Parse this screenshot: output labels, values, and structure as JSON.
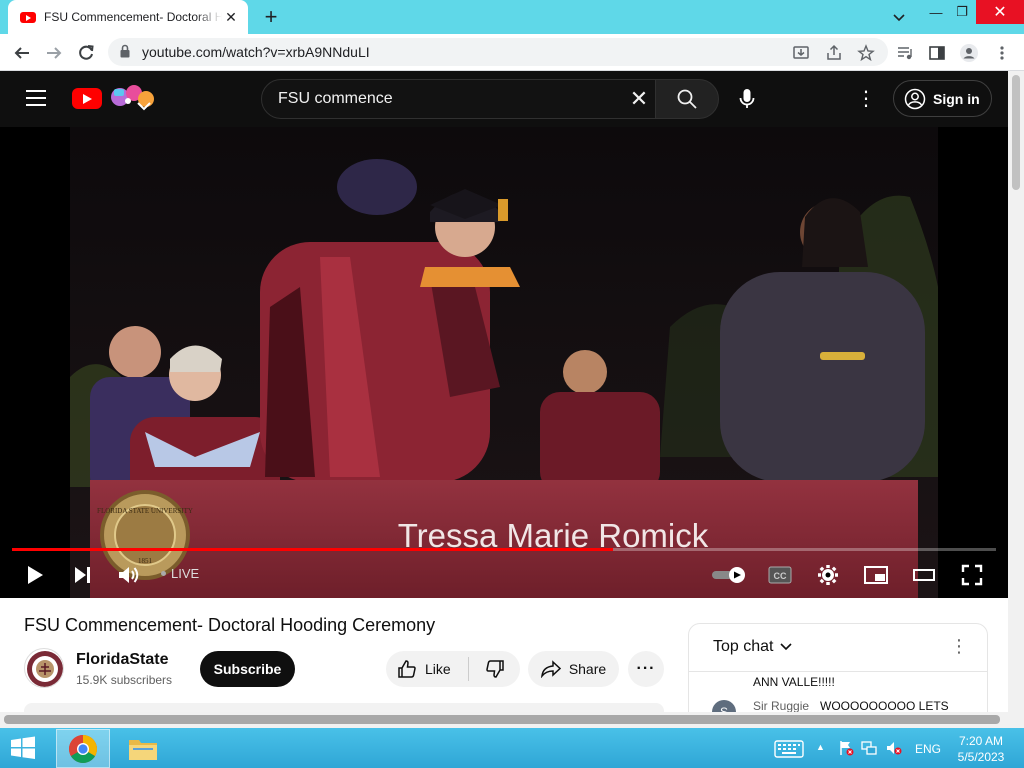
{
  "browser": {
    "tab_title": "FSU Commencement- Doctoral Hooding Ceremony - YouTube",
    "tab_close": "✕",
    "new_tab": "+",
    "url": "youtube.com/watch?v=xrbA9NNduLI",
    "window_controls": {
      "minimize": "—",
      "restore": "❐",
      "close": "✕"
    }
  },
  "youtube": {
    "search_value": "FSU commence",
    "search_clear": "✕",
    "more_menu": "⋮",
    "signin_label": "Sign in"
  },
  "player": {
    "caption_name": "Tressa Marie Romick",
    "live_label": "LIVE",
    "progress_fraction": 0.611,
    "seal_text": "FLORIDA STATE UNIVERSITY",
    "seal_year": "1851"
  },
  "video": {
    "title": "FSU Commencement- Doctoral Hooding Ceremony",
    "channel": "FloridaState",
    "subscribers": "15.9K subscribers",
    "subscribe_label": "Subscribe",
    "like_label": "Like",
    "share_label": "Share",
    "more_label": "···"
  },
  "chat": {
    "title": "Top chat",
    "menu": "⋮",
    "messages": [
      {
        "author": "",
        "text": "ANN VALLE!!!!!"
      },
      {
        "author": "Sir Ruggie",
        "initial": "S",
        "text": "WOOOOOOOOO LETS"
      }
    ]
  },
  "taskbar": {
    "language": "ENG",
    "time": "7:20 AM",
    "date": "5/5/2023",
    "tray_arrow": "▲"
  },
  "colors": {
    "tabstrip": "#5fd8e8",
    "youtube_red": "#ff0000",
    "banner": "#8a2a36",
    "taskbar": "#2fa6d6",
    "close_button": "#e81123"
  }
}
